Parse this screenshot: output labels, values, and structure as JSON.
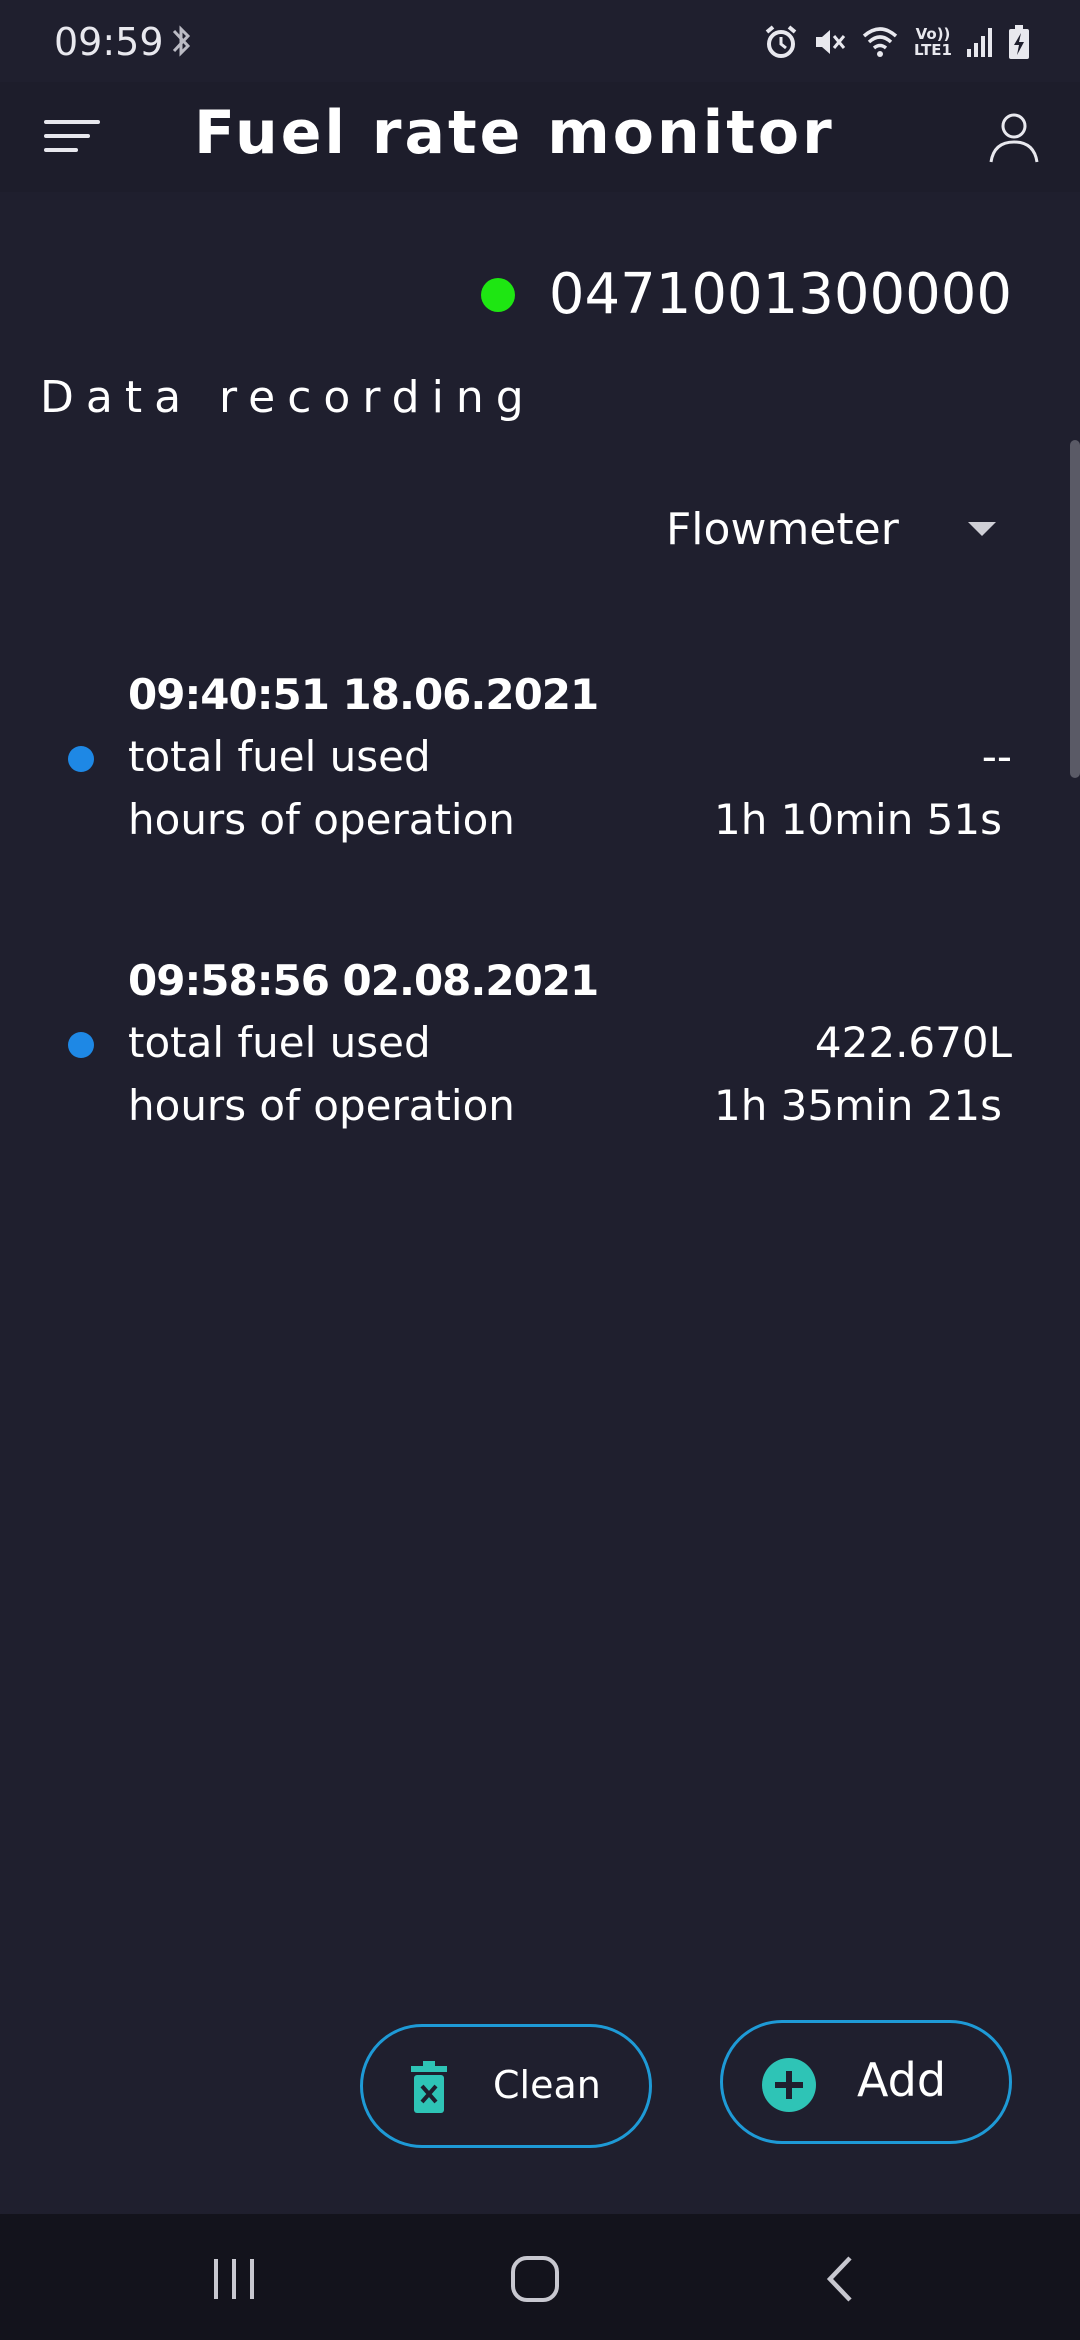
{
  "status_bar": {
    "time": "09:59",
    "icons": [
      "bluetooth-icon",
      "alarm-icon",
      "mute-icon",
      "wifi-icon",
      "volte-icon",
      "signal-icon",
      "battery-icon"
    ],
    "volte_line1": "Vo))",
    "volte_line2": "LTE1"
  },
  "app_bar": {
    "title": "Fuel rate monitor",
    "menu_icon": "menu-icon",
    "account_icon": "account-icon"
  },
  "device": {
    "id": "0471001300000",
    "status_color": "#1ee612"
  },
  "section": {
    "title": "Data recording"
  },
  "dropdown": {
    "selected": "Flowmeter"
  },
  "records": [
    {
      "timestamp": "09:40:51 18.06.2021",
      "fuel_label": "total fuel used",
      "fuel_value": "--",
      "hours_label": "hours of operation",
      "hours_value": "1h 10min 51s"
    },
    {
      "timestamp": "09:58:56 02.08.2021",
      "fuel_label": "total fuel used",
      "fuel_value": "422.670L",
      "hours_label": "hours of operation",
      "hours_value": "1h 35min 21s"
    }
  ],
  "buttons": {
    "clean_label": "Clean",
    "add_label": "Add"
  },
  "colors": {
    "background": "#1f1f2e",
    "accent_outline": "#1e9ad6",
    "icon_teal": "#2ec4b6",
    "bullet_blue": "#1e88e5"
  }
}
